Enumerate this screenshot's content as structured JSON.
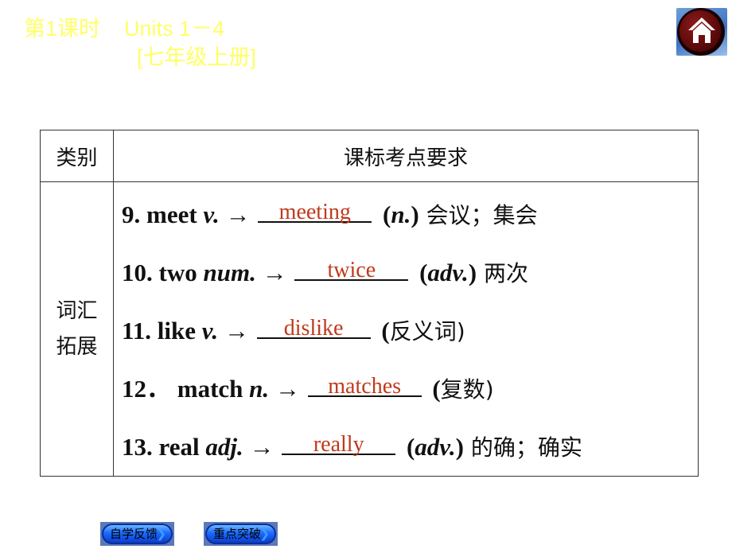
{
  "header": {
    "lesson": "第1课时",
    "units": "Units 1－4",
    "grade": "[七年级上册]"
  },
  "home_button": {
    "icon": "home-icon",
    "label": "home"
  },
  "table": {
    "headers": [
      "类别",
      "课标考点要求"
    ],
    "category": [
      "词汇",
      "拓展"
    ],
    "rows": [
      {
        "prefix": "9. meet ",
        "pos": "v.",
        "arrow": " → ",
        "answer": "meeting",
        "suffix_open": " (",
        "suffix_pos": "n.",
        "suffix_close": ")",
        "note": " 会议；集会"
      },
      {
        "prefix": "10. two ",
        "pos": "num.",
        "arrow": " → ",
        "answer": "twice",
        "suffix_open": " (",
        "suffix_pos": "adv.",
        "suffix_close": ")",
        "note": " 两次"
      },
      {
        "prefix": "11. like ",
        "pos": "v.",
        "arrow": " → ",
        "answer": "dislike",
        "suffix_open": " (",
        "suffix_pos": "",
        "suffix_close": "",
        "note": "反义词)"
      },
      {
        "prefix": "12．  match ",
        "pos": "n.",
        "arrow": " → ",
        "answer": "matches",
        "suffix_open": " (",
        "suffix_pos": "",
        "suffix_close": "",
        "note": "复数)"
      },
      {
        "prefix": "13. real ",
        "pos": "adj.",
        "arrow": " → ",
        "answer": "really",
        "suffix_open": " (",
        "suffix_pos": "adv.",
        "suffix_close": ")",
        "note": " 的确；确实"
      }
    ]
  },
  "footer": {
    "buttons": [
      {
        "label": "自学反馈",
        "icon": "chevron-right-icon"
      },
      {
        "label": "重点突破",
        "icon": "chevron-right-icon"
      }
    ]
  },
  "colors": {
    "title": "#ffff66",
    "answer": "#c0391b",
    "button": "#1a6cff"
  }
}
